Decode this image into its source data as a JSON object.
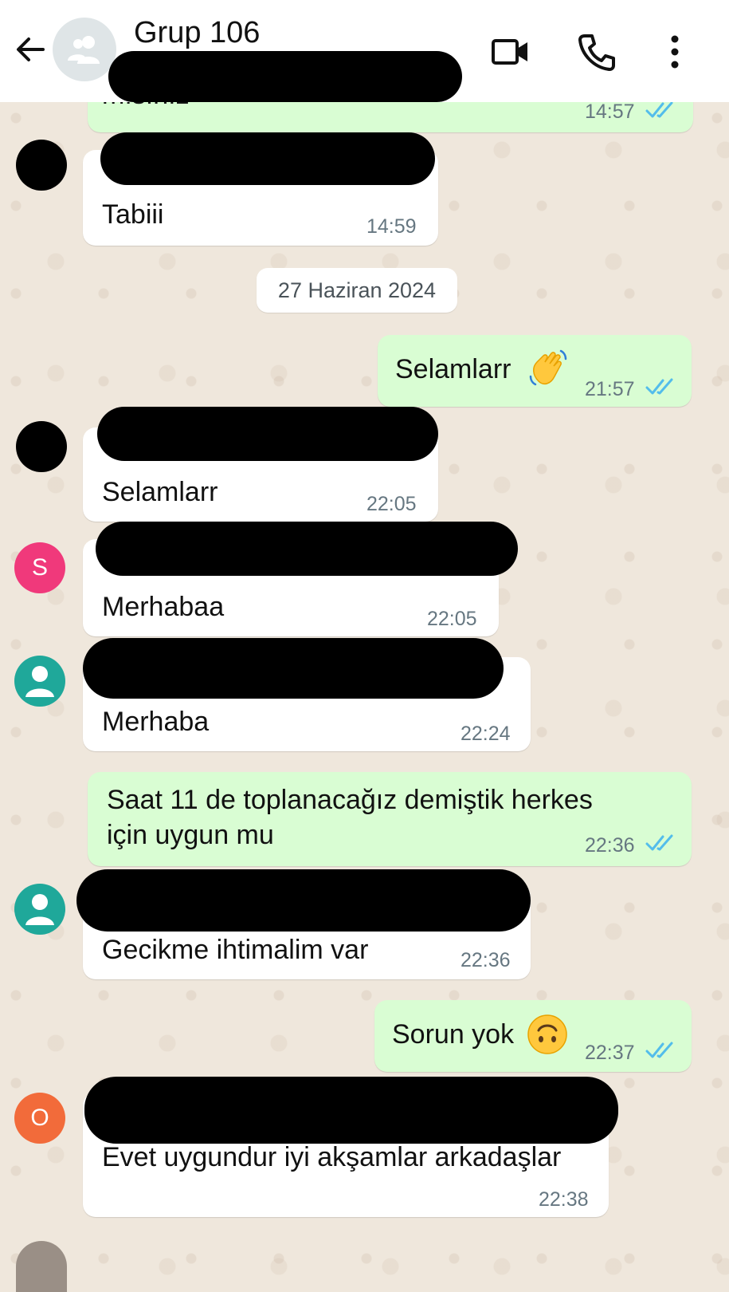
{
  "header": {
    "title": "Grup 106"
  },
  "date_chip": "27 Haziran 2024",
  "messages": [
    {
      "text": "mısınız",
      "time": "14:57"
    },
    {
      "text": "Tabiii",
      "time": "14:59"
    },
    {
      "text": "Selamlarr",
      "time": "21:57"
    },
    {
      "text": "Selamlarr",
      "time": "22:05"
    },
    {
      "text": "Merhabaa",
      "time": "22:05"
    },
    {
      "text": "Merhaba",
      "time": "22:24"
    },
    {
      "line1": "Saat 11 de toplanacağız demiştik herkes",
      "line2": "için uygun mu",
      "time": "22:36"
    },
    {
      "text": "Gecikme ihtimalim var",
      "time": "22:36"
    },
    {
      "text": "Sorun yok",
      "time": "22:37"
    },
    {
      "text": "Evet uygundur iyi akşamlar arkadaşlar",
      "time": "22:38"
    }
  ],
  "avatars": {
    "s_letter": "S",
    "o_letter": "O"
  },
  "colors": {
    "outgoing": "#d9fdd3",
    "incoming": "#ffffff",
    "tick_blue": "#53bdeb",
    "avatar_pink": "#f0397b",
    "avatar_teal": "#1fa89a",
    "avatar_orange": "#f26b3a"
  }
}
